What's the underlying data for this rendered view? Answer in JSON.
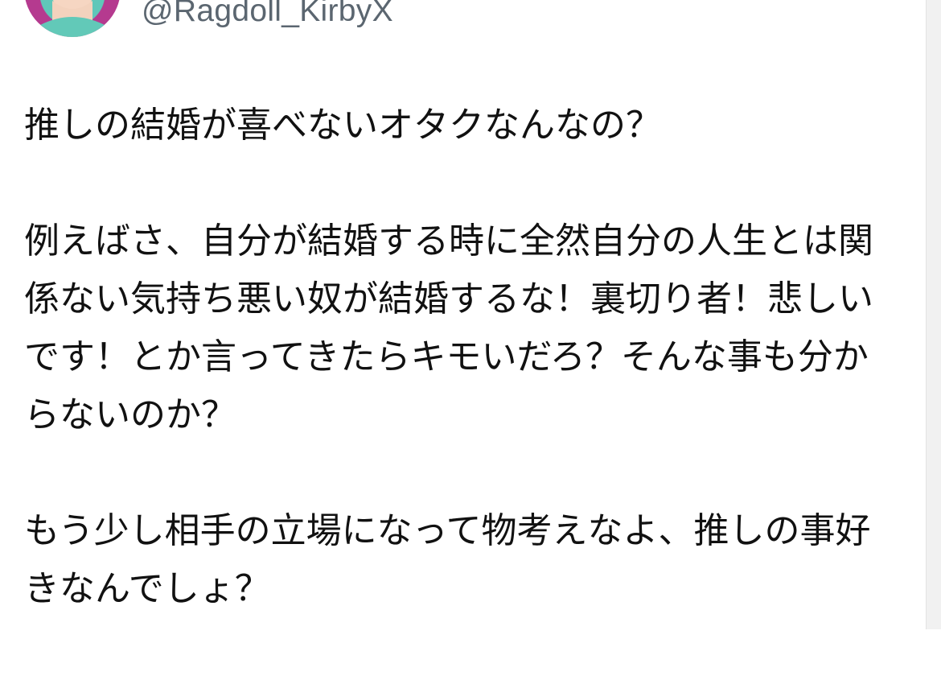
{
  "author": {
    "handle": "@Ragdoll_KirbyX",
    "avatar_icon": "profile-avatar-anime-character"
  },
  "tweet": {
    "paragraphs": [
      "推しの結婚が喜べないオタクなんなの？",
      "例えばさ、自分が結婚する時に全然自分の人生とは関係ない気持ち悪い奴が結婚するな！裏切り者！悲しいです！とか言ってきたらキモいだろ？そんな事も分からないのか？",
      "もう少し相手の立場になって物考えなよ、推しの事好きなんでしょ？"
    ]
  },
  "colors": {
    "text": "#111111",
    "handle": "#5b6670",
    "background": "#ffffff"
  }
}
